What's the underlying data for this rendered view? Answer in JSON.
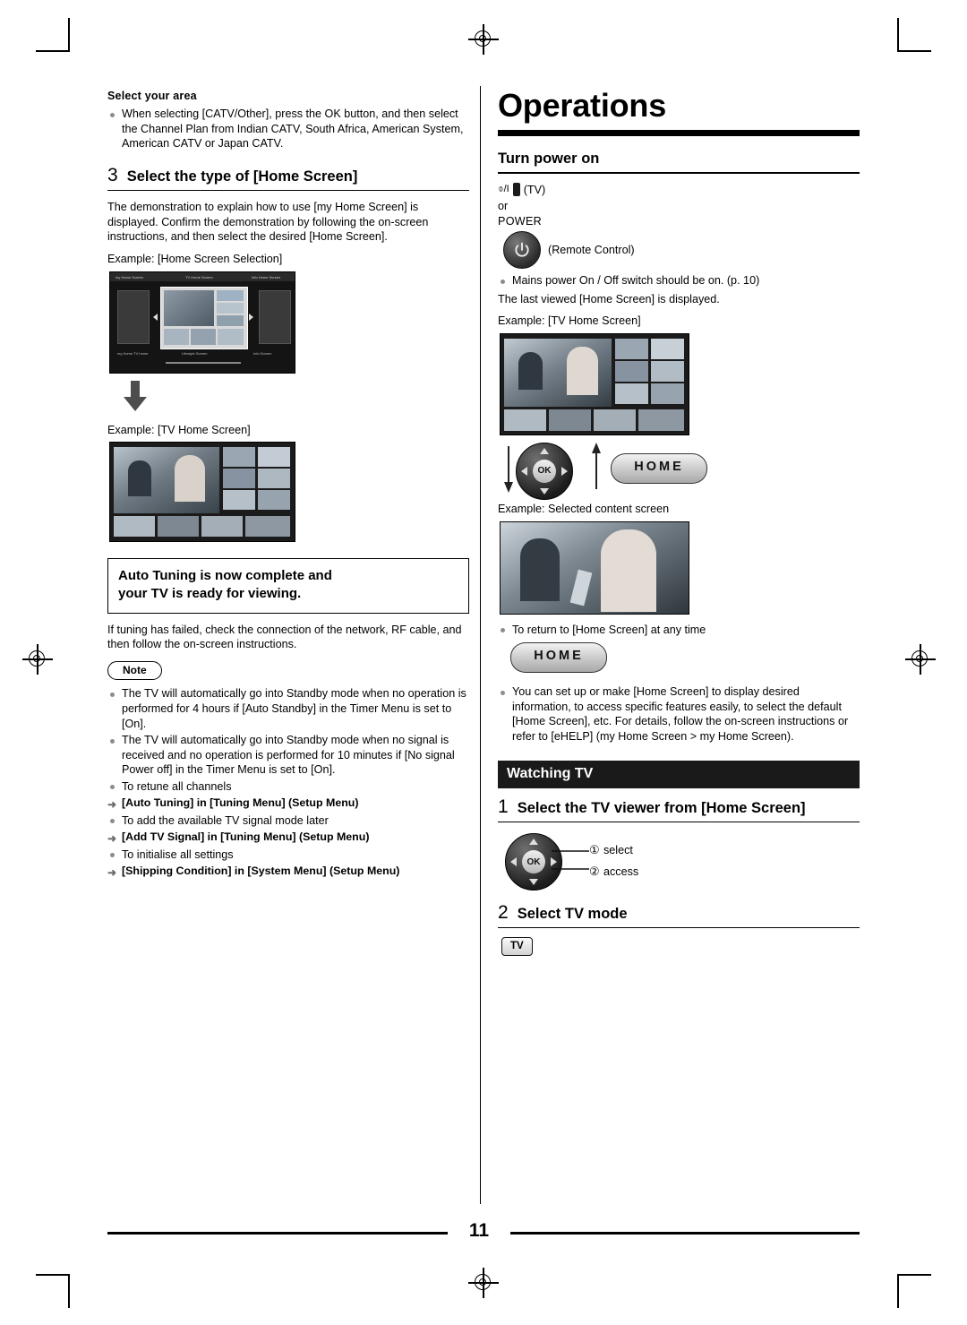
{
  "page": {
    "number": "11",
    "title": "Operations"
  },
  "left": {
    "select_area_heading": "Select your area",
    "select_area_bullets": [
      "When selecting [CATV/Other], press the OK button, and then select the Channel Plan from Indian CATV, South Africa, American System, American CATV or Japan CATV."
    ],
    "step3": {
      "number": "3",
      "title": "Select the type of [Home Screen]",
      "body": "The demonstration to explain how to use [my Home Screen] is displayed. Confirm the demonstration by following the on-screen instructions, and then select the desired [Home Screen].",
      "example1_caption": "Example: [Home Screen Selection]",
      "example2_caption": "Example: [TV Home Screen]"
    },
    "notice": {
      "line1": "Auto Tuning is now complete and",
      "line2": "your TV is ready for viewing."
    },
    "notice_body": "If tuning has failed, check the connection of the network, RF cable, and then follow the on-screen instructions.",
    "note_label": "Note",
    "note_bullets": [
      "The TV will automatically go into Standby mode when no operation is performed for 4 hours if [Auto Standby] in the Timer Menu is set to [On].",
      "The TV will automatically go into Standby mode when no signal is received and no operation is performed for 10 minutes if [No signal Power off] in the Timer Menu is set to [On].",
      "To retune all channels",
      "To add the available TV signal mode later",
      "To initialise all settings"
    ],
    "arrow_refs": [
      "[Auto Tuning] in [Tuning Menu] (Setup Menu)",
      "[Add TV Signal] in [Tuning Menu] (Setup Menu)",
      "[Shipping Condition] in [System Menu] (Setup Menu)"
    ]
  },
  "right": {
    "turn_power_on": {
      "heading": "Turn power on",
      "tv_label": "(TV)",
      "or_label": "or",
      "power_label": "POWER",
      "remote_label": "(Remote Control)",
      "bullet": "Mains power On / Off switch should be on. (p. 10)",
      "note_line": "The last viewed [Home Screen] is displayed.",
      "example1_caption": "Example: [TV Home Screen]",
      "example2_caption": "Example: Selected content screen",
      "home_key_label": "HOME",
      "return_bullet": "To return to [Home Screen] at any time",
      "setup_bullet": "You can set up or make [Home Screen] to display desired information, to access specific features easily, to select the default [Home Screen], etc. For details, follow the on-screen instructions or refer to [eHELP] (my Home Screen > my Home Screen)."
    },
    "watching_tv": {
      "bar_heading": "Watching TV",
      "step1": {
        "number": "1",
        "title": "Select the TV viewer from [Home Screen]",
        "select_label": "select",
        "access_label": "access",
        "select_marker": "①",
        "access_marker": "②"
      },
      "step2": {
        "number": "2",
        "title": "Select TV mode",
        "chip_label": "TV"
      }
    }
  },
  "icons": {
    "power_symbol": "⏻",
    "ok_label": "OK",
    "arrow_marker": "➜",
    "down_arrow": "down-arrow"
  },
  "colors": {
    "accent_black": "#000000",
    "bar_bg": "#1a1a1a",
    "bullet_gray": "#8c8c8c"
  }
}
